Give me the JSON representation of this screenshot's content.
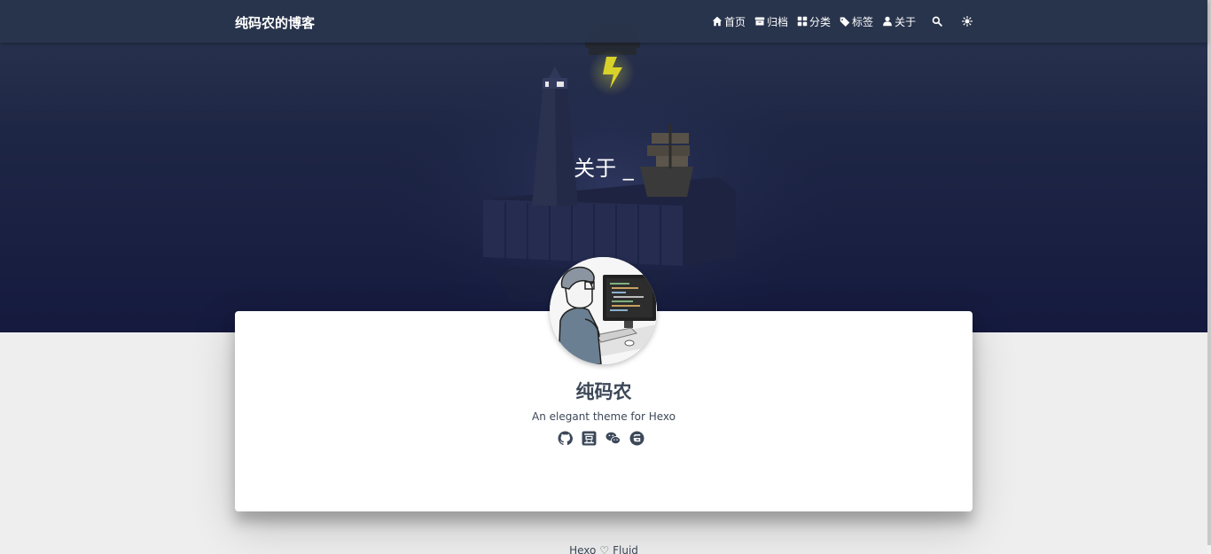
{
  "navbar": {
    "brand": "纯码农的博客",
    "items": [
      {
        "label": "首页",
        "icon": "home-icon"
      },
      {
        "label": "归档",
        "icon": "archive-icon"
      },
      {
        "label": "分类",
        "icon": "category-icon"
      },
      {
        "label": "标签",
        "icon": "tag-icon"
      },
      {
        "label": "关于",
        "icon": "user-icon"
      }
    ],
    "search_icon": "search-icon",
    "theme_icon": "sun-icon"
  },
  "hero": {
    "title": "关于 _"
  },
  "profile": {
    "name": "纯码农",
    "intro": "An elegant theme for Hexo",
    "links": [
      "github-icon",
      "douban-icon",
      "wechat-icon",
      "gitee-icon"
    ]
  },
  "footer": {
    "left": "Hexo",
    "heart": "♡",
    "right": "Fluid"
  },
  "colors": {
    "navbar": "#28344c",
    "hero_dark": "#151a3e",
    "text": "#3c4858",
    "page_bg": "#eeeeee",
    "bolt": "#d8d22a"
  }
}
